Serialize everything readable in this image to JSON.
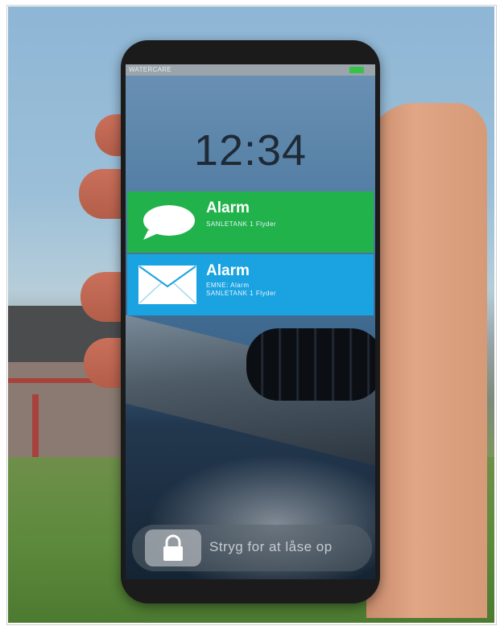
{
  "status_bar": {
    "carrier": "WATERCARE"
  },
  "lock_screen": {
    "time": "12:34"
  },
  "notifications": [
    {
      "title": "Alarm",
      "lines": [
        "SANLETANK 1 Flyder"
      ],
      "icon": "message-bubble-icon",
      "color": "#21b24b"
    },
    {
      "title": "Alarm",
      "lines": [
        "EMNE: Alarm",
        "SANLETANK 1 Flyder"
      ],
      "icon": "envelope-icon",
      "color": "#1aa3e0"
    }
  ],
  "unlock": {
    "label": "Stryg for at låse op"
  }
}
